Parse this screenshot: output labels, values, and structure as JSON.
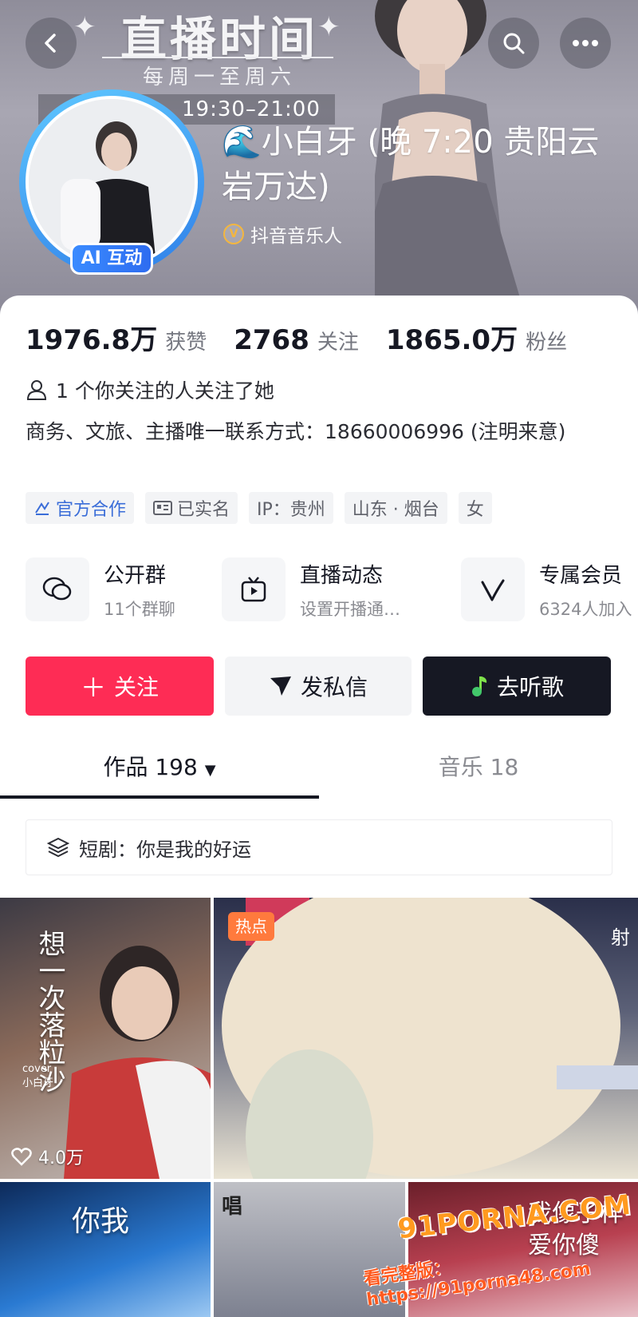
{
  "banner": {
    "title": "直播时间",
    "subtitle": "每周一至周六",
    "live_time": "19:30–21:00"
  },
  "profile": {
    "nickname": "🌊小白牙 (晚 7:20 贵阳云岩万达)",
    "ai_badge": "AI 互动",
    "verification": "抖音音乐人",
    "verify_icon_text": "V"
  },
  "stats": [
    {
      "value": "1976.8万",
      "label": "获赞"
    },
    {
      "value": "2768",
      "label": "关注"
    },
    {
      "value": "1865.0万",
      "label": "粉丝"
    }
  ],
  "mutual_follow": "1 个你关注的人关注了她",
  "bio": "商务、文旅、主播唯一联系方式：18660006996 (注明来意)",
  "tags": [
    {
      "label": "官方合作",
      "icon": "cooperation-icon"
    },
    {
      "label": "已实名",
      "icon": "id-card-icon"
    },
    {
      "label": "IP：贵州"
    },
    {
      "label": "山东 · 烟台"
    },
    {
      "label": "女"
    }
  ],
  "features": [
    {
      "title": "公开群",
      "subtitle": "11个群聊",
      "icon": "chat-group-icon"
    },
    {
      "title": "直播动态",
      "subtitle": "设置开播通…",
      "icon": "tv-icon"
    },
    {
      "title": "专属会员",
      "subtitle": "6324人加入",
      "icon": "v-heart-icon"
    }
  ],
  "actions": {
    "follow": "关注",
    "message": "发私信",
    "music": "去听歌"
  },
  "tabs": {
    "works": "作品 198",
    "music": "音乐 18"
  },
  "drama": "短剧：你是我的好运",
  "videos": [
    {
      "likes": "4.0万",
      "overlay_text": "想一次落粒沙",
      "cover_text": "cover 小白牙"
    },
    {
      "badge": "热点",
      "overlay_text": "射"
    },
    {
      "overlay_text": "你我"
    },
    {
      "overlay_text": "唱"
    },
    {
      "overlay_text": "我像子样爱你傻"
    }
  ],
  "watermark": {
    "brand": "91PORNA.COM",
    "url": "看完整版：https://91porna48.com"
  },
  "colors": {
    "follow_red": "#fe2c55",
    "dark": "#161823",
    "avatar_ring": "#2f7fe8",
    "hot_orange": "#ff7a3d"
  }
}
